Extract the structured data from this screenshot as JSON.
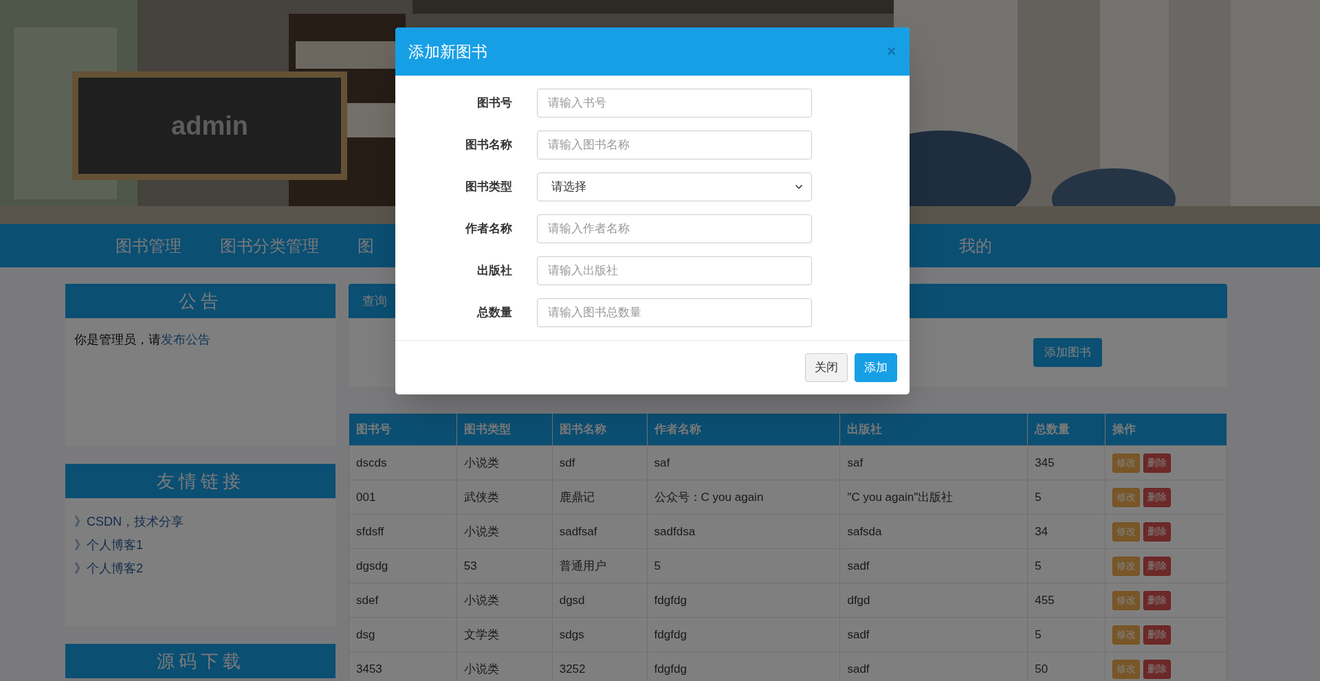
{
  "header": {
    "board_text": "admin"
  },
  "nav": {
    "items": [
      {
        "label": "图书管理"
      },
      {
        "label": "图书分类管理"
      },
      {
        "label": "图"
      }
    ],
    "user_menu": "我的"
  },
  "sidebar": [
    {
      "title": "公告",
      "kind": "notice",
      "text": "你是管理员，请",
      "link": "发布公告"
    },
    {
      "title": "友情链接",
      "kind": "links",
      "links": [
        "》CSDN，技术分享",
        "》个人博客1",
        "》个人博客2"
      ]
    },
    {
      "title": "源码下载",
      "kind": "empty"
    }
  ],
  "query_panel": {
    "title": "查询",
    "add_button": "添加图书"
  },
  "table": {
    "columns": [
      "图书号",
      "图书类型",
      "图书名称",
      "作者名称",
      "出版社",
      "总数量",
      "操作"
    ],
    "rows": [
      {
        "cells": [
          "dscds",
          "小说类",
          "sdf",
          "saf",
          "saf",
          "345"
        ],
        "actions": [
          "修改",
          "删除"
        ]
      },
      {
        "cells": [
          "001",
          "武侠类",
          "鹿鼎记",
          "公众号：C you again",
          "\"C you again\"出版社",
          "5"
        ],
        "actions": [
          "修改",
          "删除"
        ]
      },
      {
        "cells": [
          "sfdsff",
          "小说类",
          "sadfsaf",
          "sadfdsa",
          "safsda",
          "34"
        ],
        "actions": [
          "修改",
          "删除"
        ]
      },
      {
        "cells": [
          "dgsdg",
          "53",
          "普通用户",
          "5",
          "sadf",
          "5"
        ],
        "actions": [
          "修改",
          "删除"
        ]
      },
      {
        "cells": [
          "sdef",
          "小说类",
          "dgsd",
          "fdgfdg",
          "dfgd",
          "455"
        ],
        "actions": [
          "修改",
          "删除"
        ]
      },
      {
        "cells": [
          "dsg",
          "文学类",
          "sdgs",
          "fdgfdg",
          "sadf",
          "5"
        ],
        "actions": [
          "修改",
          "删除"
        ]
      },
      {
        "cells": [
          "3453",
          "小说类",
          "3252",
          "fdgfdg",
          "sadf",
          "50"
        ],
        "actions": [
          "修改",
          "删除"
        ]
      }
    ]
  },
  "modal": {
    "title": "添加新图书",
    "close": "×",
    "fields": [
      {
        "label": "图书号",
        "kind": "input",
        "placeholder": "请输入书号"
      },
      {
        "label": "图书名称",
        "kind": "input",
        "placeholder": "请输入图书名称"
      },
      {
        "label": "图书类型",
        "kind": "select",
        "value": "请选择"
      },
      {
        "label": "作者名称",
        "kind": "input",
        "placeholder": "请输入作者名称"
      },
      {
        "label": "出版社",
        "kind": "input",
        "placeholder": "请输入出版社"
      },
      {
        "label": "总数量",
        "kind": "input",
        "placeholder": "请输入图书总数量"
      }
    ],
    "buttons": [
      {
        "label": "关闭",
        "kind": "secondary"
      },
      {
        "label": "添加",
        "kind": "primary"
      }
    ]
  }
}
